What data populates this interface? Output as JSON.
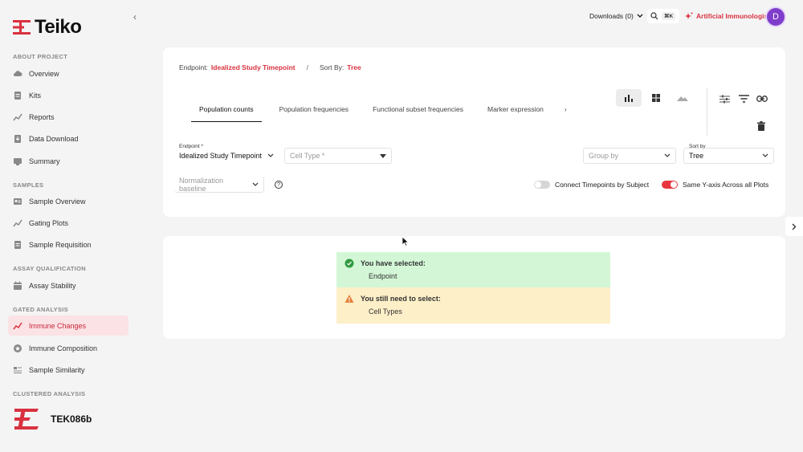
{
  "brand": {
    "name": "Teiko",
    "accent": "#d9323f"
  },
  "sidebar": {
    "collapse_icon": "chevron-left-icon",
    "sections": {
      "about": "ABOUT PROJECT",
      "samples": "SAMPLES",
      "assay": "ASSAY QUALIFICATION",
      "gated": "GATED ANALYSIS",
      "clustered": "CLUSTERED ANALYSIS"
    },
    "items": [
      {
        "label": "Overview",
        "icon": "cloud-icon"
      },
      {
        "label": "Kits",
        "icon": "document-icon"
      },
      {
        "label": "Reports",
        "icon": "chart-line-icon"
      },
      {
        "label": "Data Download",
        "icon": "download-icon"
      },
      {
        "label": "Summary",
        "icon": "summary-icon"
      },
      {
        "label": "Sample Overview",
        "icon": "id-card-icon"
      },
      {
        "label": "Gating Plots",
        "icon": "chart-line-icon"
      },
      {
        "label": "Sample Requisition",
        "icon": "document-icon"
      },
      {
        "label": "Assay Stability",
        "icon": "calendar-icon"
      },
      {
        "label": "Immune Changes",
        "icon": "chart-line-icon",
        "active": true
      },
      {
        "label": "Immune Composition",
        "icon": "star-icon"
      },
      {
        "label": "Sample Similarity",
        "icon": "list-icon"
      }
    ],
    "project": "TEK086b"
  },
  "topbar": {
    "downloads": "Downloads (0)",
    "shortcut": "⌘K",
    "ai": "Artificial Immunologist",
    "avatar": "D"
  },
  "breadcrumb": {
    "endpoint_label": "Endpoint:",
    "endpoint_value": "Idealized Study Timepoint",
    "separator": "/",
    "sort_label": "Sort By:",
    "sort_value": "Tree"
  },
  "tabs": [
    "Population counts",
    "Population frequencies",
    "Functional subset frequencies",
    "Marker expression"
  ],
  "tab_more": "›",
  "controls": {
    "endpoint_label": "Endpoint *",
    "endpoint_value": "Idealized Study Timepoint",
    "cell_type_placeholder": "Cell Type *",
    "group_by_placeholder": "Group by",
    "sort_by_label": "Sort by",
    "sort_by_value": "Tree",
    "normalization_placeholder": "Normalization baseline",
    "help": "?",
    "connect_label": "Connect Timepoints by Subject",
    "connect_on": false,
    "same_y_label": "Same Y-axis Across all Plots",
    "same_y_on": true
  },
  "status": {
    "selected_title": "You have selected:",
    "selected_value": "Endpoint",
    "need_title": "You still need to select:",
    "need_value": "Cell Types"
  }
}
